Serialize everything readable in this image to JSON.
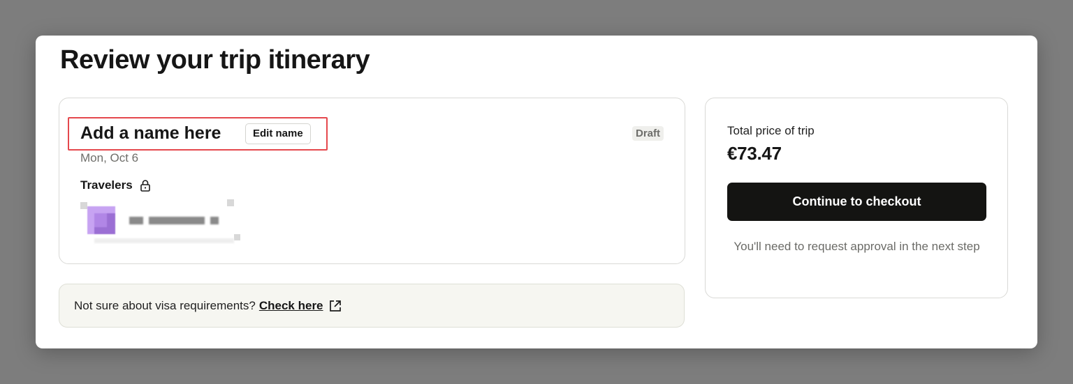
{
  "page": {
    "title": "Review your trip itinerary"
  },
  "trip": {
    "name": "Add a name here",
    "edit_name_label": "Edit name",
    "status_badge": "Draft",
    "date": "Mon, Oct 6",
    "travelers_label": "Travelers",
    "travelers_icon": "lock-icon"
  },
  "visa_banner": {
    "text": "Not sure about visa requirements?",
    "link_label": "Check here",
    "link_icon": "external-link-icon"
  },
  "summary": {
    "total_label": "Total price of trip",
    "total_value": "€73.47",
    "checkout_label": "Continue to checkout",
    "approval_note": "You'll need to request approval in the next step"
  },
  "colors": {
    "highlight_outline": "#e5484d",
    "primary_button": "#141412",
    "avatar": "#b186e6"
  }
}
